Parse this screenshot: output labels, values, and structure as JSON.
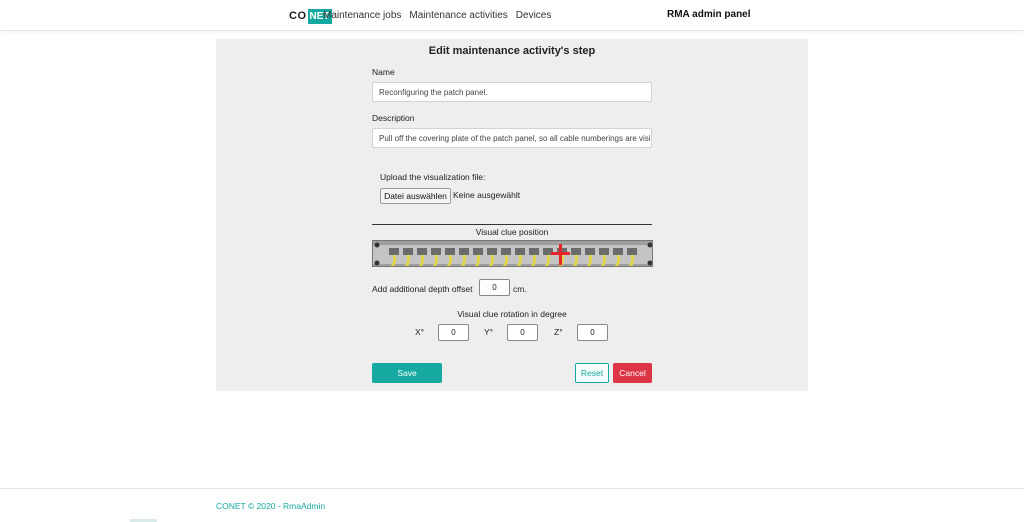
{
  "navbar": {
    "logo_left": "CO",
    "logo_right": "NET",
    "links": [
      "Maintenance jobs",
      "Maintenance activities",
      "Devices"
    ],
    "title": "RMA admin panel"
  },
  "form": {
    "title": "Edit maintenance activity's step",
    "name_label": "Name",
    "name_value": "Reconfiguring the patch panel.",
    "description_label": "Description",
    "description_value": "Pull off the covering plate of the patch panel, so all cable numberings are visible.",
    "upload_label": "Upload the visualization file:",
    "file_button": "Datei auswählen",
    "file_status": "Keine ausgewählt",
    "visual_clue_label": "Visual clue position",
    "depth_label": "Add additional depth offset",
    "depth_value": "0",
    "depth_unit": "cm.",
    "rotation_label": "Visual clue rotation in degree",
    "rotation": {
      "x_label": "X°",
      "x_value": "0",
      "y_label": "Y°",
      "y_value": "0",
      "z_label": "Z°",
      "z_value": "0"
    },
    "save_label": "Save",
    "reset_label": "Reset",
    "cancel_label": "Cancel"
  },
  "footer": {
    "text": "CONET © 2020 - RmaAdmin"
  },
  "colors": {
    "accent": "#16a9a1",
    "danger": "#dc3545",
    "marker": "#e8242b"
  },
  "icons": {
    "clue_marker": "red-cross-marker-icon"
  }
}
